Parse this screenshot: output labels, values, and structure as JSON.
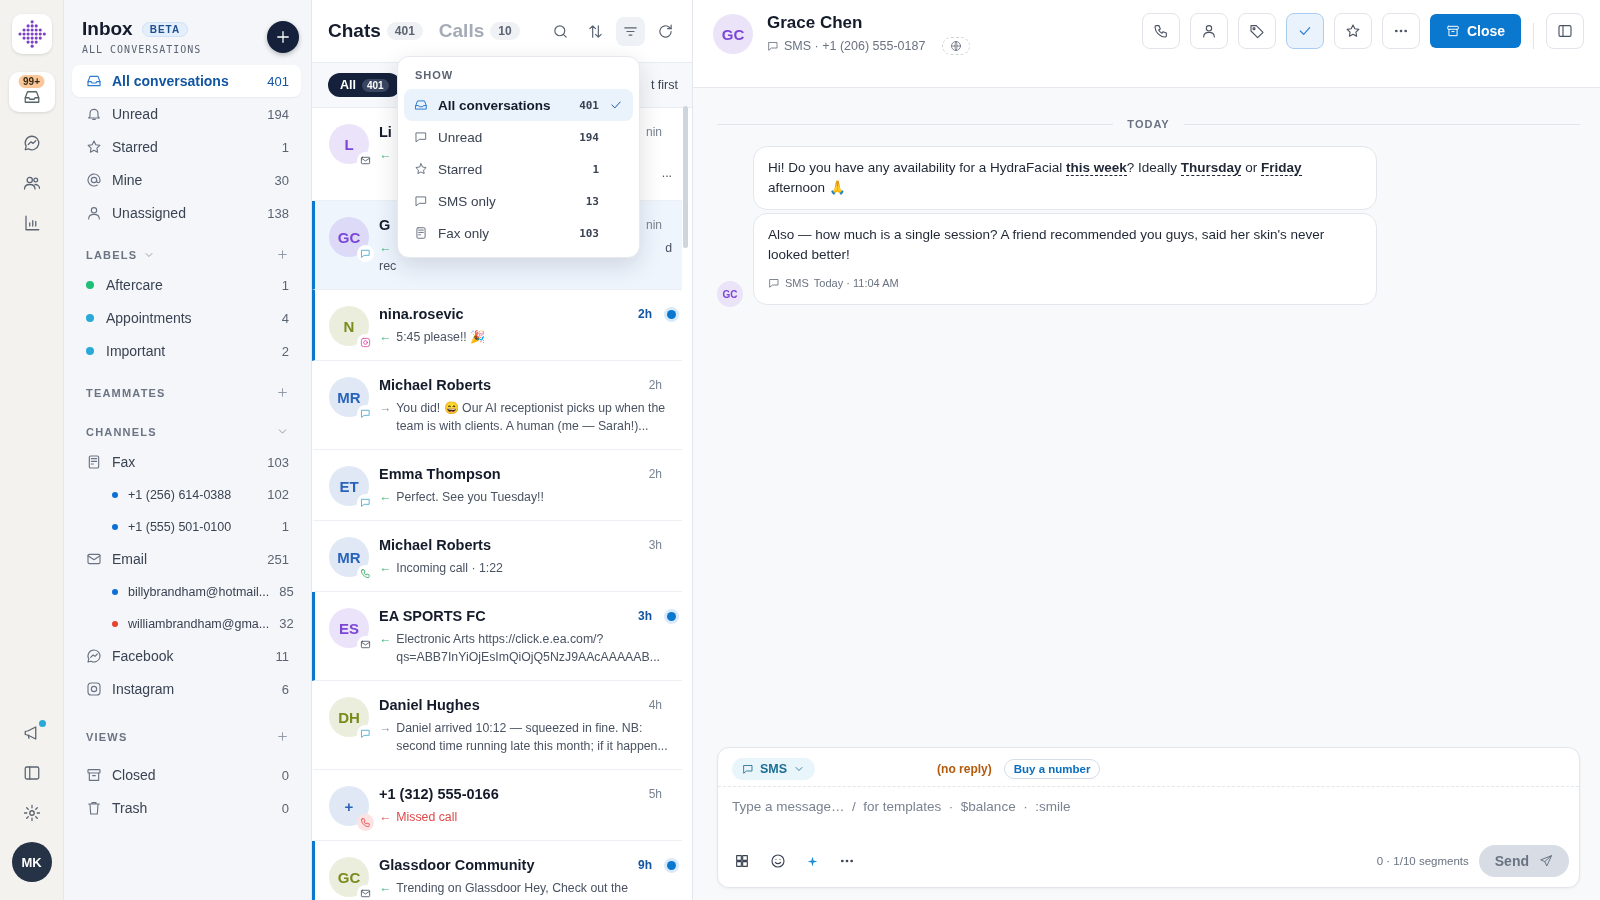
{
  "rail": {
    "badge": "99+",
    "avatar": "MK"
  },
  "sidebar": {
    "title": "Inbox",
    "badge": "BETA",
    "subtitle": "ALL CONVERSATIONS",
    "folders": [
      {
        "label": "All conversations",
        "count": "401",
        "selected": true
      },
      {
        "label": "Unread",
        "count": "194",
        "selected": false
      },
      {
        "label": "Starred",
        "count": "1",
        "selected": false
      },
      {
        "label": "Mine",
        "count": "30",
        "selected": false
      },
      {
        "label": "Unassigned",
        "count": "138",
        "selected": false
      }
    ],
    "labels": {
      "heading": "LABELS",
      "items": [
        {
          "label": "Aftercare",
          "count": "1",
          "color": "#1fbf75"
        },
        {
          "label": "Appointments",
          "count": "4",
          "color": "#2aa8d8"
        },
        {
          "label": "Important",
          "count": "2",
          "color": "#2aa8d8"
        }
      ]
    },
    "teammates": {
      "heading": "TEAMMATES"
    },
    "channels": {
      "heading": "CHANNELS",
      "items": [
        {
          "label": "Fax",
          "count": "103",
          "children": [
            {
              "label": "+1 (256) 614-0388",
              "count": "102",
              "color": "#0b6fd6"
            },
            {
              "label": "+1 (555) 501-0100",
              "count": "1",
              "color": "#0b6fd6"
            }
          ]
        },
        {
          "label": "Email",
          "count": "251",
          "children": [
            {
              "label": "billybrandham@hotmail...",
              "count": "85",
              "color": "#0b6fd6"
            },
            {
              "label": "williambrandham@gma...",
              "count": "32",
              "color": "#e8412f"
            }
          ]
        },
        {
          "label": "Facebook",
          "count": "11"
        },
        {
          "label": "Instagram",
          "count": "6"
        }
      ]
    },
    "views": {
      "heading": "VIEWS",
      "items": [
        {
          "label": "Closed",
          "count": "0"
        },
        {
          "label": "Trash",
          "count": "0"
        }
      ]
    }
  },
  "chat_list": {
    "tabs": [
      {
        "label": "Chats",
        "count": "401",
        "selected": true
      },
      {
        "label": "Calls",
        "count": "10",
        "selected": false
      }
    ],
    "filter_chip": {
      "label": "All",
      "count": "401"
    },
    "sort_fragment": "t first",
    "rows": [
      {
        "avatar": "L",
        "color": "#7b45d6",
        "kind": "email",
        "name": "Li",
        "time": "nin",
        "arrow": "←",
        "tail": "...",
        "selected": false,
        "unread": false
      },
      {
        "avatar": "GC",
        "color": "#7b45d6",
        "kind": "sms",
        "name": "G",
        "time": "nin",
        "arrow": "←",
        "tail": "d",
        "preview": "rec",
        "selected": true,
        "unread": false
      },
      {
        "avatar": "N",
        "color": "#7b8a1c",
        "kind": "instagram",
        "name": "nina.rosevic",
        "time": "2h",
        "arrow": "←",
        "preview": "5:45 please!! 🎉",
        "selected": false,
        "unread": true
      },
      {
        "avatar": "MR",
        "color": "#2a63b8",
        "kind": "sms",
        "name": "Michael Roberts",
        "time": "2h",
        "arrow": "→",
        "preview": "You did! 😄 Our AI receptionist picks up when the team is with clients. A human (me — Sarah!)...",
        "selected": false,
        "unread": false
      },
      {
        "avatar": "ET",
        "color": "#2a63b8",
        "kind": "sms",
        "name": "Emma Thompson",
        "time": "2h",
        "arrow": "←",
        "preview": "Perfect. See you Tuesday!!",
        "selected": false,
        "unread": false
      },
      {
        "avatar": "MR",
        "color": "#2a63b8",
        "kind": "call",
        "name": "Michael Roberts",
        "time": "3h",
        "arrow": "←",
        "preview": "Incoming call · 1:22",
        "selected": false,
        "unread": false
      },
      {
        "avatar": "ES",
        "color": "#7b45d6",
        "kind": "email",
        "name": "EA SPORTS FC",
        "time": "3h",
        "arrow": "←",
        "preview": "Electronic Arts https://click.e.ea.com/?qs=ABB7InYiOjEsImQiOjQ5NzJ9AAcAAAAAB...",
        "selected": false,
        "unread": true
      },
      {
        "avatar": "DH",
        "color": "#7b8a1c",
        "kind": "sms",
        "name": "Daniel Hughes",
        "time": "4h",
        "arrow": "→",
        "preview": "Daniel arrived 10:12 — squeezed in fine. NB: second time running late this month; if it happen...",
        "selected": false,
        "unread": false
      },
      {
        "avatar": "+",
        "color": "#2a63b8",
        "kind": "missed",
        "name": "+1 (312) 555-0166",
        "time": "5h",
        "arrow": "←",
        "preview": "Missed call",
        "selected": false,
        "unread": false
      },
      {
        "avatar": "GC",
        "color": "#7b8a1c",
        "kind": "email",
        "name": "Glassdoor Community",
        "time": "9h",
        "arrow": "←",
        "preview": "Trending on Glassdoor Hey, Check out the",
        "selected": false,
        "unread": true
      }
    ],
    "dropdown": {
      "heading": "SHOW",
      "items": [
        {
          "label": "All conversations",
          "count": "401",
          "selected": true
        },
        {
          "label": "Unread",
          "count": "194",
          "selected": false
        },
        {
          "label": "Starred",
          "count": "1",
          "selected": false
        },
        {
          "label": "SMS only",
          "count": "13",
          "selected": false
        },
        {
          "label": "Fax only",
          "count": "103",
          "selected": false
        }
      ]
    }
  },
  "conversation": {
    "avatar": "GC",
    "name": "Grace Chen",
    "subtitle": "SMS · +1 (206) 555-0187",
    "done": true,
    "close_label": "Close",
    "day_divider": "TODAY",
    "messages": [
      {
        "text": "Hi! Do you have any availability for a HydraFacial **this week**? Ideally **Thursday** or **Friday** afternoon 🙏"
      },
      {
        "text": "Also — how much is a single session? A friend recommended you guys, said her skin's never looked better!",
        "channel": "SMS",
        "time": "Today · 11:04 AM",
        "avatar": "GC"
      }
    ],
    "composer": {
      "channel": "SMS",
      "status": "(no reply)",
      "buy_label": "Buy a number",
      "placeholder": "Type a message…  /  for templates  ·  $balance  ·  :smile",
      "counter": "0 · 1/10 segments",
      "send_label": "Send",
      "send_disabled": true
    }
  }
}
